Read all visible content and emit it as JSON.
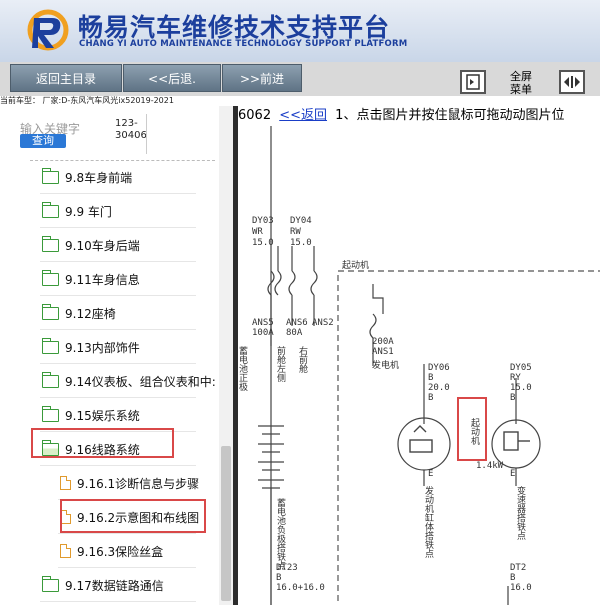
{
  "header": {
    "title_cn": "畅易汽车维修技术支持平台",
    "title_en": "CHANG YI AUTO MAINTENANCE TECHNOLOGY SUPPORT PLATFORM",
    "brand_color": "#1c3f9d"
  },
  "toolbar": {
    "home_label": "返回主目录",
    "back_label": "<<后退.",
    "forward_label": ">>前进",
    "fullscreen_line1": "全屏",
    "fullscreen_line2": "菜单"
  },
  "car_info": "当前车型： 厂家:D-东风汽车风光ix52019-2021",
  "sidebar": {
    "search_placeholder": "输入关键字",
    "search_code": "123-30406",
    "search_button": "查询",
    "items": [
      {
        "label": "9.8车身前端",
        "type": "folder"
      },
      {
        "label": "9.9 车门",
        "type": "folder"
      },
      {
        "label": "9.10车身后端",
        "type": "folder"
      },
      {
        "label": "9.11车身信息",
        "type": "folder"
      },
      {
        "label": "9.12座椅",
        "type": "folder"
      },
      {
        "label": "9.13内部饰件",
        "type": "folder"
      },
      {
        "label": "9.14仪表板、组合仪表和中:",
        "type": "folder"
      },
      {
        "label": "9.15娱乐系统",
        "type": "folder"
      },
      {
        "label": "9.16线路系统",
        "type": "folder-open"
      },
      {
        "label": "9.16.1诊断信息与步骤",
        "type": "doc"
      },
      {
        "label": "9.16.2示意图和布线图",
        "type": "doc"
      },
      {
        "label": "9.16.3保险丝盒",
        "type": "doc"
      },
      {
        "label": "9.17数据链路通信",
        "type": "folder"
      }
    ]
  },
  "main": {
    "doc_id": "6062",
    "back_link": "<<返回",
    "instruction": "1、点击图片并按住鼠标可拖动动图片位"
  },
  "diagram": {
    "wire_labels": [
      "DY03",
      "WR",
      "15.0",
      "DY04",
      "RW",
      "15.0"
    ],
    "fuse_labels": [
      "ANS5",
      "100A",
      "ANS6",
      "80A",
      "ANS2"
    ],
    "starter_title": "起动机",
    "fuse_200": [
      "200A",
      "ANS1"
    ],
    "generator": "发电机",
    "wire_dy06": [
      "DY06",
      "B",
      "20.0",
      "B"
    ],
    "wire_dy05": [
      "DY05",
      "RY",
      "15.0",
      "B"
    ],
    "starter_box_label": "起动机",
    "rating": "1.4kW",
    "e_label": "E",
    "vertical_texts": [
      "蓄电池负极搭铁点",
      "发动机缸体搭铁点",
      "变速器搭铁点",
      "蓄电池正极",
      "前舱左侧",
      "右前舱"
    ],
    "wire_dt23": [
      "DT23",
      "B",
      "16.0+16.0"
    ],
    "wire_dt21": [
      "DT2",
      "B",
      "16.0"
    ]
  }
}
